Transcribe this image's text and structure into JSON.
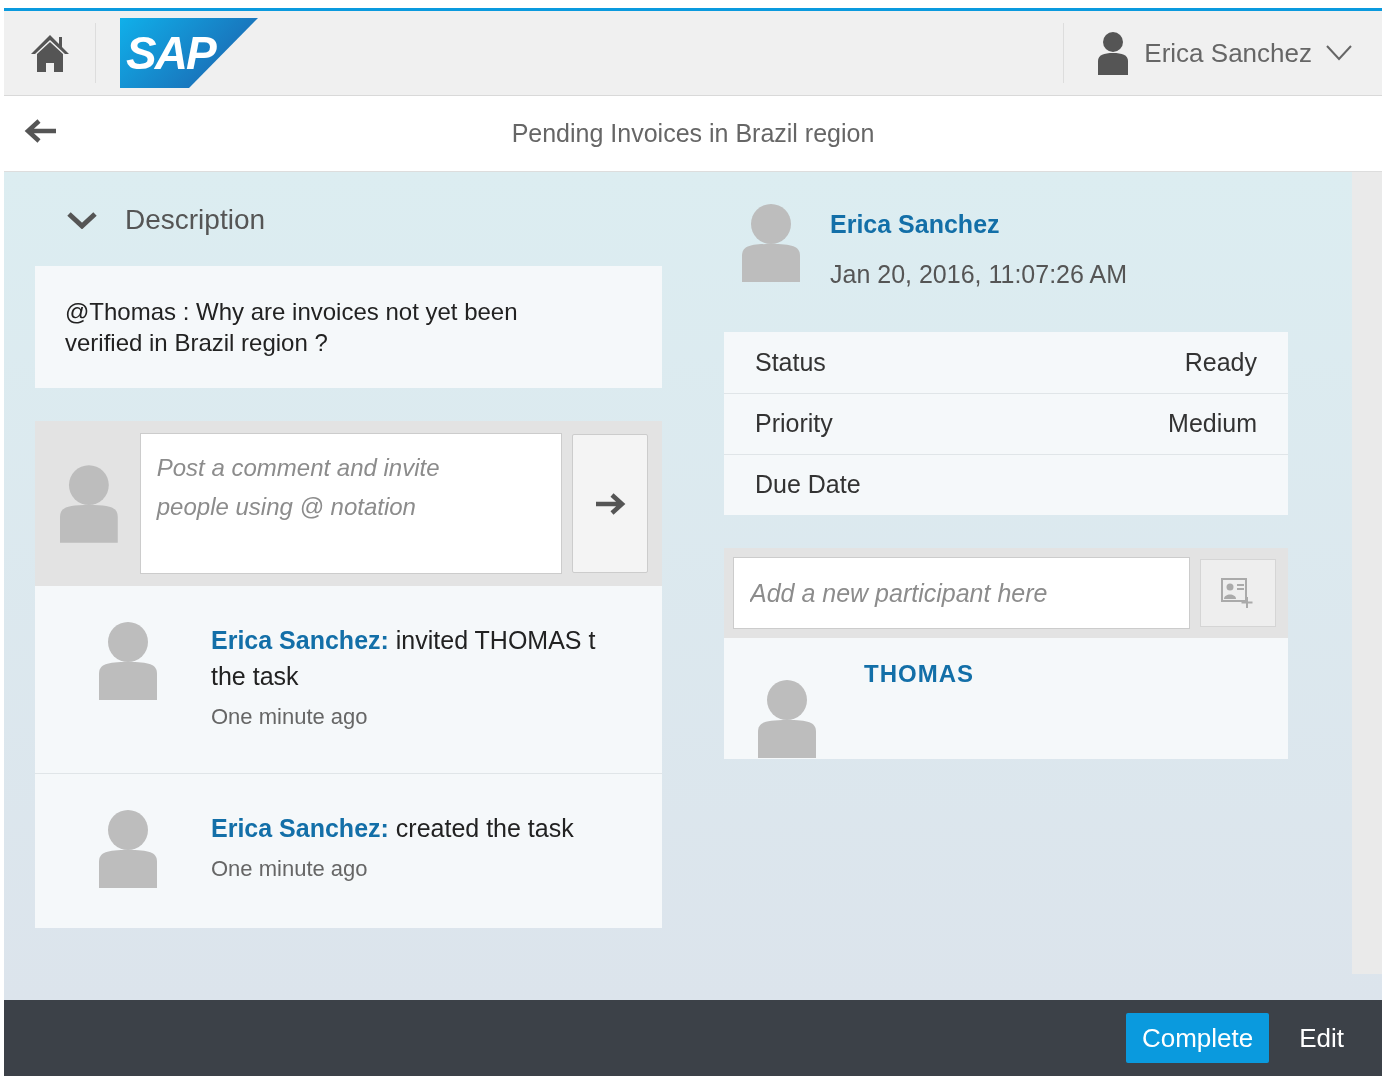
{
  "header": {
    "logo": "SAP",
    "user_name": "Erica Sanchez"
  },
  "title": "Pending Invoices in Brazil region",
  "description": {
    "heading": "Description",
    "expanded": true,
    "text": "@Thomas : Why are invoices not yet been verified in Brazil region ?"
  },
  "comment_box": {
    "placeholder": "Post a comment and invite people using @ notation"
  },
  "feed": [
    {
      "author": "Erica Sanchez:",
      "text": "invited THOMAS t\nthe task",
      "time": "One minute ago"
    },
    {
      "author": "Erica Sanchez:",
      "text": "created the task",
      "time": "One minute ago"
    }
  ],
  "creator": {
    "name": "Erica Sanchez",
    "date": "Jan 20, 2016, 11:07:26 AM"
  },
  "attributes": [
    {
      "label": "Status",
      "value": "Ready"
    },
    {
      "label": "Priority",
      "value": "Medium"
    },
    {
      "label": "Due Date"
    }
  ],
  "participant_field": {
    "placeholder": "Add a new participant here"
  },
  "participants": [
    {
      "name": "THOMAS"
    }
  ],
  "footer_buttons": [
    {
      "label": "Complete",
      "kind": "primary"
    },
    {
      "label": "Edit",
      "kind": "plain"
    }
  ]
}
